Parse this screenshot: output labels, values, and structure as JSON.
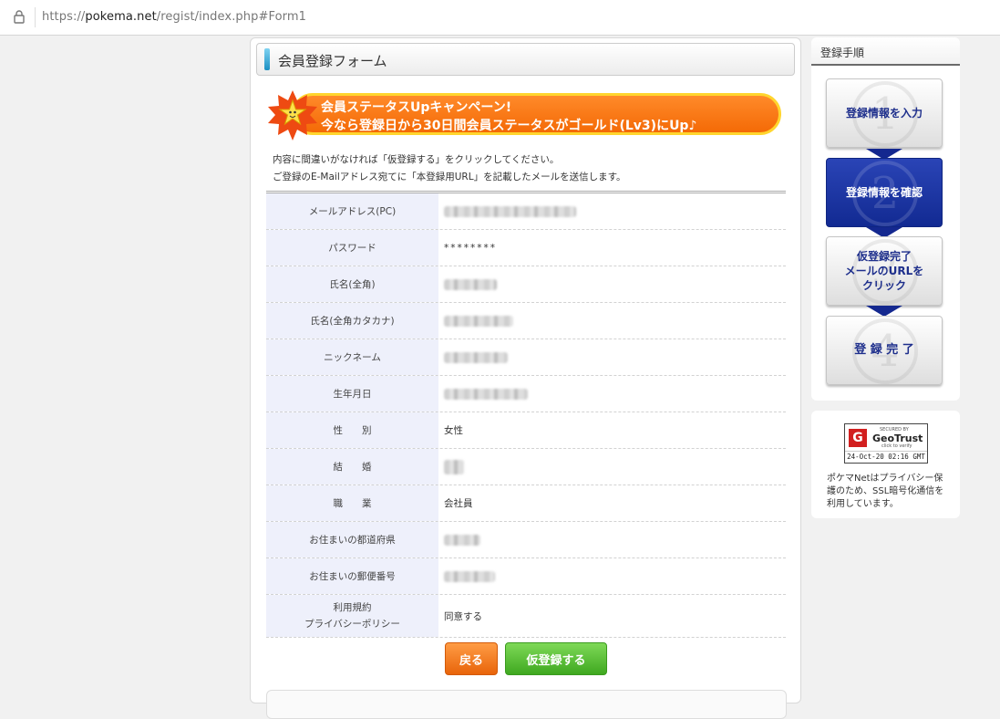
{
  "browser": {
    "url_prefix": "https://",
    "url_host": "pokema.net",
    "url_path": "/regist/index.php#Form1"
  },
  "form": {
    "title": "会員登録フォーム",
    "banner_line1": "会員ステータスUpキャンペーン!",
    "banner_line2": "今なら登録日から30日間会員ステータスがゴールド(Lv3)にUp♪",
    "note1": "内容に間違いがなければ「仮登録する」をクリックしてください。",
    "note2": "ご登録のE-Mailアドレス宛てに「本登録用URL」を記載したメールを送信します。",
    "rows": [
      {
        "label": "メールアドレス(PC)",
        "value": "",
        "blurred": true
      },
      {
        "label": "パスワード",
        "value": "********",
        "blurred": false
      },
      {
        "label": "氏名(全角)",
        "value": "",
        "blurred": true
      },
      {
        "label": "氏名(全角カタカナ)",
        "value": "",
        "blurred": true
      },
      {
        "label": "ニックネーム",
        "value": "",
        "blurred": true
      },
      {
        "label": "生年月日",
        "value": "",
        "blurred": true
      },
      {
        "label": "性　　別",
        "value": "女性",
        "blurred": false
      },
      {
        "label": "結　　婚",
        "value": "",
        "blurred": true
      },
      {
        "label": "職　　業",
        "value": "会社員",
        "blurred": false
      },
      {
        "label": "お住まいの都道府県",
        "value": "",
        "blurred": true
      },
      {
        "label": "お住まいの郵便番号",
        "value": "",
        "blurred": true
      },
      {
        "label": "利用規約",
        "label2": "プライバシーポリシー",
        "value": "同意する",
        "blurred": false
      }
    ],
    "back_label": "戻る",
    "submit_label": "仮登録する"
  },
  "sidebar": {
    "title": "登録手順",
    "steps": [
      {
        "num": "1",
        "label": "登録情報を入力",
        "active": false
      },
      {
        "num": "2",
        "label": "登録情報を確認",
        "active": true
      },
      {
        "num": "3",
        "label_lines": [
          "仮登録完了",
          "メールのURLを",
          "クリック"
        ],
        "active": false
      },
      {
        "num": "4",
        "label": "登 録 完 了",
        "active": false
      }
    ]
  },
  "security": {
    "seal_top": "SECURED BY",
    "seal_brand": "GeoTrust",
    "seal_sub": "click to verify",
    "seal_date": "24-Oct-20 02:16 GMT",
    "text": "ポケマNetはプライバシー保護のため、SSL暗号化通信を利用しています。"
  },
  "colors": {
    "accent_orange": "#f46a06",
    "accent_green": "#3fa820",
    "step_active": "#14288f",
    "label_bg": "#eef0fb"
  }
}
